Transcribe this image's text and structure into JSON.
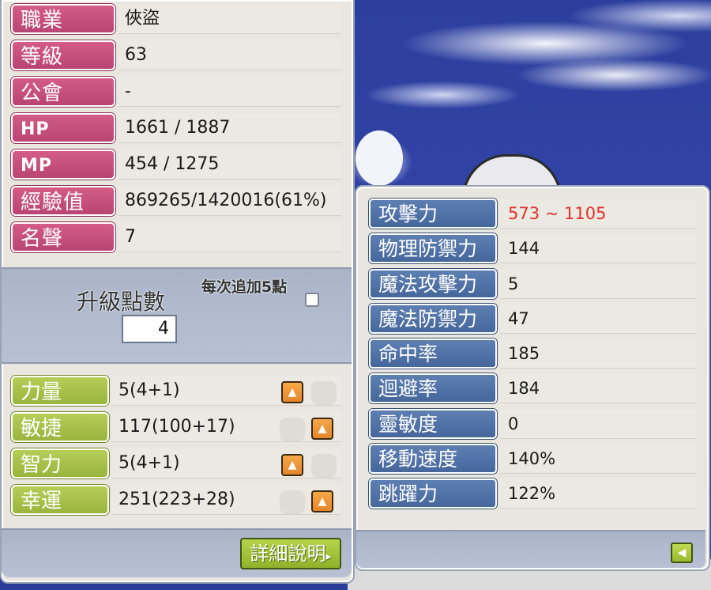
{
  "character_info": [
    {
      "label": "職業",
      "value": "俠盜"
    },
    {
      "label": "等級",
      "value": "63"
    },
    {
      "label": "公會",
      "value": "-"
    },
    {
      "label": "HP",
      "value": "1661 / 1887"
    },
    {
      "label": "MP",
      "value": "454 / 1275"
    },
    {
      "label": "經驗值",
      "value": "869265/1420016(61%)"
    },
    {
      "label": "名聲",
      "value": "7"
    }
  ],
  "ability_points": {
    "label": "升級點數",
    "value": "4",
    "auto_label": "每次追加5點",
    "auto_checked": false
  },
  "stats": [
    {
      "label": "力量",
      "value": "5(4+1)"
    },
    {
      "label": "敏捷",
      "value": "117(100+17)"
    },
    {
      "label": "智力",
      "value": "5(4+1)"
    },
    {
      "label": "幸運",
      "value": "251(223+28)"
    }
  ],
  "detail_button": {
    "label": "詳細說明"
  },
  "detail_stats": [
    {
      "label": "攻擊力",
      "value": "573 ~ 1105",
      "color": "#e0322c"
    },
    {
      "label": "物理防禦力",
      "value": "144"
    },
    {
      "label": "魔法攻擊力",
      "value": "5"
    },
    {
      "label": "魔法防禦力",
      "value": "47"
    },
    {
      "label": "命中率",
      "value": "185"
    },
    {
      "label": "迴避率",
      "value": "184"
    },
    {
      "label": "靈敏度",
      "value": "0"
    },
    {
      "label": "移動速度",
      "value": "140%"
    },
    {
      "label": "跳躍力",
      "value": "122%"
    }
  ],
  "colors": {
    "info_label": "#c64d7c",
    "stat_label": "#a9c04a",
    "detail_label": "#5272a7",
    "up_button": "#ee972f"
  },
  "icons": {
    "up": "arrow-up-icon",
    "collapse": "arrow-left-icon"
  }
}
